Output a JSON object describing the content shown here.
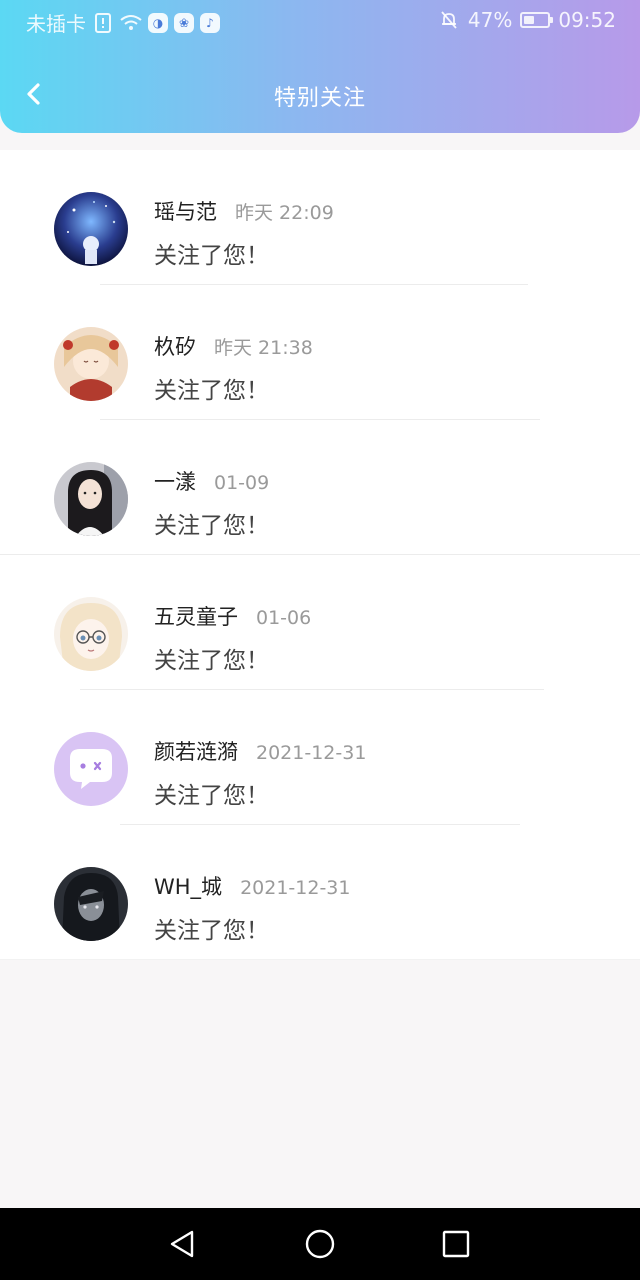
{
  "status_bar": {
    "carrier": "未插卡",
    "battery_percent": "47%",
    "battery_level": 0.47,
    "time": "09:52",
    "icons": [
      "sim-alert-icon",
      "wifi-icon",
      "app-icon-qq",
      "app-icon-baidu",
      "app-icon-music",
      "bell-off-icon",
      "battery-icon"
    ]
  },
  "header": {
    "title": "特别关注",
    "gradient_start": "#5bd8f3",
    "gradient_end": "#b79ae9"
  },
  "list": {
    "items": [
      {
        "name": "瑶与范",
        "time": "昨天 22:09",
        "message": "关注了您！",
        "avatar": "avatar-night-sky"
      },
      {
        "name": "杦矽",
        "time": "昨天 21:38",
        "message": "关注了您！",
        "avatar": "avatar-anime-girl-red"
      },
      {
        "name": "一漾",
        "time": "01-09",
        "message": "关注了您！",
        "avatar": "avatar-dark-hair-girl"
      },
      {
        "name": "五灵童子",
        "time": "01-06",
        "message": "关注了您！",
        "avatar": "avatar-anime-glasses"
      },
      {
        "name": "颜若涟漪",
        "time": "2021-12-31",
        "message": "关注了您！",
        "avatar": "avatar-default-chat"
      },
      {
        "name": "WH_城",
        "time": "2021-12-31",
        "message": "关注了您！",
        "avatar": "avatar-dark-character"
      }
    ]
  },
  "nav_bar": {
    "icons": [
      "back-triangle-icon",
      "home-circle-icon",
      "recents-square-icon"
    ]
  }
}
